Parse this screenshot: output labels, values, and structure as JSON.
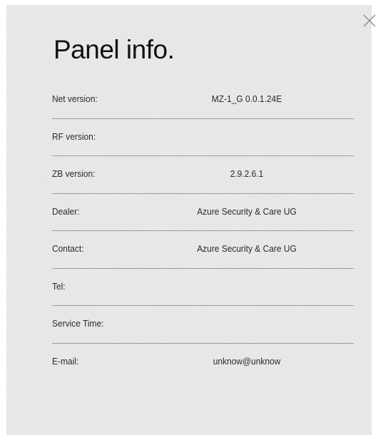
{
  "dialog": {
    "title": "Panel info.",
    "close_icon": "close-x-icon"
  },
  "rows": [
    {
      "label": "Net version:",
      "value": "MZ-1_G 0.0.1.24E"
    },
    {
      "label": "RF version:",
      "value": ""
    },
    {
      "label": "ZB version:",
      "value": "2.9.2.6.1"
    },
    {
      "label": "Dealer:",
      "value": "Azure Security & Care UG"
    },
    {
      "label": "Contact:",
      "value": "Azure Security & Care UG"
    },
    {
      "label": "Tel:",
      "value": ""
    },
    {
      "label": "Service Time:",
      "value": ""
    },
    {
      "label": "E-mail:",
      "value": "unknow@unknow"
    }
  ],
  "colors": {
    "panel_background": "#e6e6e6",
    "divider": "#9c9c9c",
    "text": "#2a2a2a",
    "close_icon": "#8a8a8a"
  }
}
